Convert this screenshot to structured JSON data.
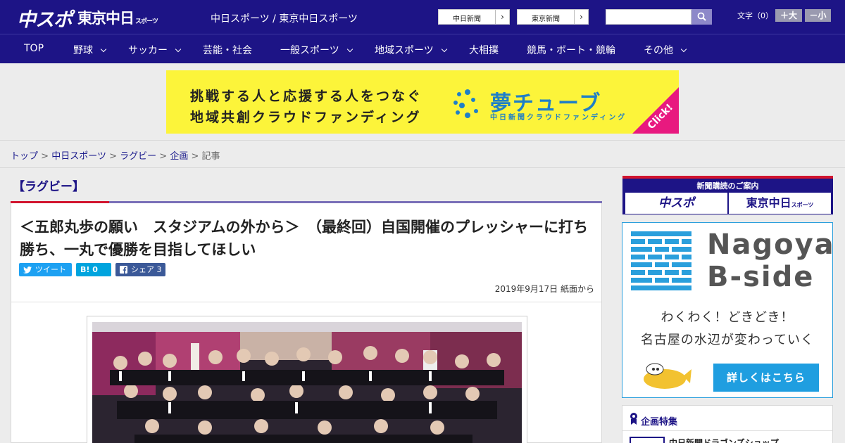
{
  "header": {
    "logo_a": "中スポ",
    "logo_b": "東京中日",
    "logo_b_small": "スポーツ",
    "site_names": "中日スポーツ / 東京中日スポーツ",
    "paper_buttons": [
      "中日新聞",
      "東京新聞"
    ],
    "font_size_label": "文字（0）",
    "font_up": "＋大",
    "font_down": "－小"
  },
  "nav": {
    "items": [
      {
        "label": "TOP"
      },
      {
        "label": "野球"
      },
      {
        "label": "サッカー"
      },
      {
        "label": "芸能・社会"
      },
      {
        "label": "一般スポーツ"
      },
      {
        "label": "地域スポーツ"
      },
      {
        "label": "大相撲"
      },
      {
        "label": "競馬・ボート・競輪"
      },
      {
        "label": "その他"
      }
    ]
  },
  "ad_banner": {
    "line1": "挑戦する人と応援する人をつなぐ",
    "line2": "地域共創クラウドファンディング",
    "brand": "夢チューブ",
    "sub": "中日新聞クラウドファンディング",
    "click": "Click!"
  },
  "breadcrumb": {
    "items": [
      "トップ",
      "中日スポーツ",
      "ラグビー",
      "企画"
    ],
    "current": "記事",
    "separator": ">"
  },
  "article": {
    "category": "【ラグビー】",
    "headline": "＜五郎丸歩の願い　スタジアムの外から＞　（最終回）自国開催のプレッシャーに打ち勝ち、一丸で優勝を目指してほしい",
    "share": {
      "tweet": "ツイート",
      "hatena": "B! 0",
      "facebook": "シェア 3"
    },
    "date": "2019年9月17日 紙面から"
  },
  "sidebar": {
    "subscribe": {
      "label": "新聞購読のご案内",
      "btn_a": "中スポ",
      "btn_b": "東京中日",
      "btn_b_small": "スポーツ"
    },
    "bside": {
      "title_line1": "Nagoya",
      "title_line2": "B-side",
      "text1": "わくわく！どきどき！",
      "text2": "名古屋の水辺が変わっていく",
      "cta": "詳しくはこちら"
    },
    "feature": {
      "title": "企画特集",
      "item": "中日新聞ドラゴンズショップ"
    }
  },
  "colors": {
    "brand_navy": "#1d1486",
    "accent_red": "#d2152f",
    "ad_yellow": "#fcf43a",
    "bside_blue": "#1f9ee0"
  }
}
